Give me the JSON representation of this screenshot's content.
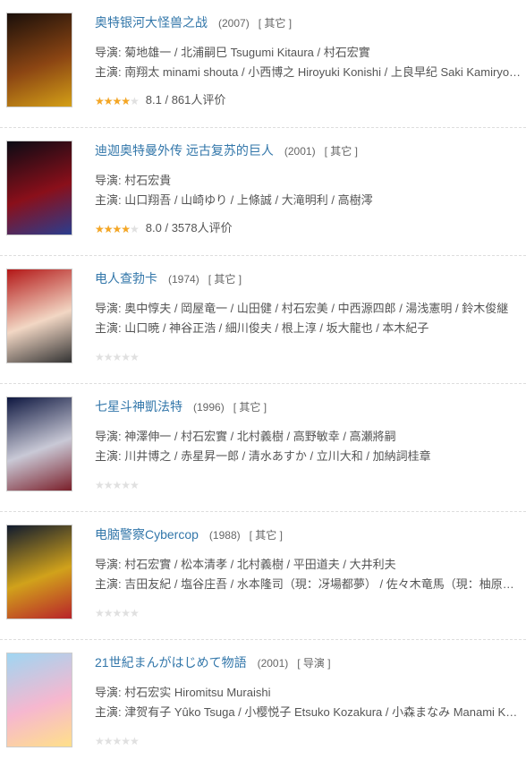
{
  "labels": {
    "director": "导演: ",
    "cast": "主演: "
  },
  "items": [
    {
      "title": "奥特银河大怪兽之战",
      "year": "(2007)",
      "tag": "[ 其它 ]",
      "director": "菊地雄一 / 北浦嗣巳 Tsugumi Kitaura / 村石宏實",
      "cast": "南翔太 minami shouta / 小西博之 Hiroyuki Konishi / 上良早纪 Saki Kamiryo…",
      "rating_fraction": 0.8,
      "score_text": "8.1 / 861人评价",
      "poster_colors": [
        "#1a0f0a",
        "#8b4513",
        "#d4a017"
      ]
    },
    {
      "title": "迪迦奥特曼外传 远古复苏的巨人",
      "year": "(2001)",
      "tag": "[ 其它 ]",
      "director": "村石宏貴",
      "cast": "山口翔吾 / 山崎ゆり / 上條誠 / 大滝明利 / 高樹澪",
      "rating_fraction": 0.8,
      "score_text": "8.0 / 3578人评价",
      "poster_colors": [
        "#0b0b14",
        "#8a0f1a",
        "#2a3d8f"
      ]
    },
    {
      "title": "电人查勃卡",
      "year": "(1974)",
      "tag": "[ 其它 ]",
      "director": "奥中惇夫 / 岡屋竜一 / 山田健 / 村石宏美 / 中西源四郎 / 湯浅憲明 / 鈴木俊継",
      "cast": "山口暁 / 神谷正浩 / 細川俊夫 / 根上淳 / 坂大龍也 / 本木紀子",
      "rating_fraction": 0,
      "score_text": "",
      "poster_colors": [
        "#b31717",
        "#f2d7c4",
        "#333333"
      ]
    },
    {
      "title": "七星斗神凱法特",
      "year": "(1996)",
      "tag": "[ 其它 ]",
      "director": "神澤伸一 / 村石宏實 / 北村義樹 / 高野敏幸 / 高瀬將嗣",
      "cast": "川井博之 / 赤星昇一郎 / 清水あすか / 立川大和 / 加納詞桂章",
      "rating_fraction": 0,
      "score_text": "",
      "poster_colors": [
        "#0e1740",
        "#c9c9d6",
        "#7a1f2a"
      ]
    },
    {
      "title": "电脑警察Cybercop",
      "year": "(1988)",
      "tag": "[ 其它 ]",
      "director": "村石宏實 / 松本清孝 / 北村義樹 / 平田道夫 / 大井利夫",
      "cast": "吉田友紀 / 塩谷庄吾 / 水本隆司（現：冴場都夢） / 佐々木竜馬（現：柚原旬…",
      "rating_fraction": 0,
      "score_text": "",
      "poster_colors": [
        "#101a2e",
        "#d1a21b",
        "#b8232a"
      ]
    },
    {
      "title": "21世紀まんがはじめて物語",
      "year": "(2001)",
      "tag": "[ 导演 ]",
      "director": "村石宏实 Hiromitsu Muraishi",
      "cast": "津贺有子 Yûko Tsuga / 小樱悦子 Etsuko Kozakura / 小森まなみ Manami Ko…",
      "rating_fraction": 0,
      "score_text": "",
      "poster_colors": [
        "#9fd6f2",
        "#f6b7cf",
        "#ffe08a"
      ]
    }
  ]
}
